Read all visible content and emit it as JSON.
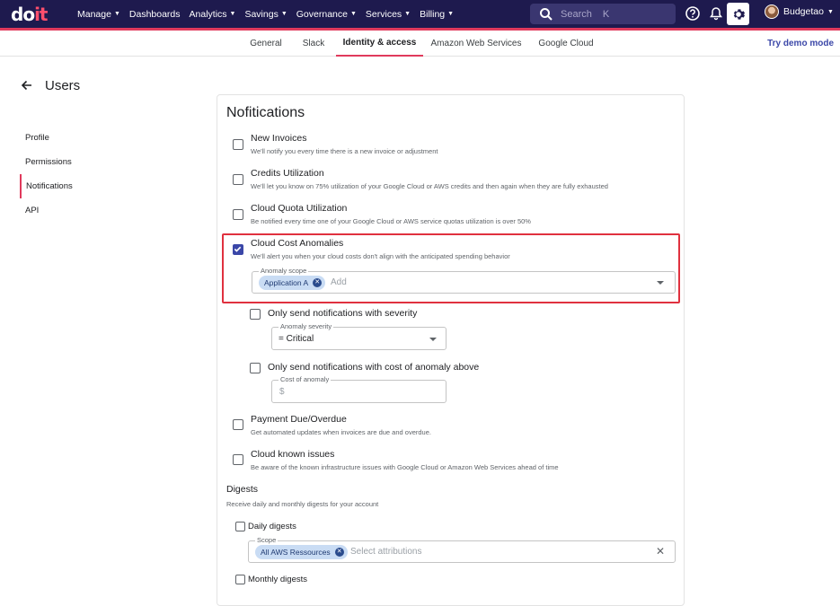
{
  "topbar": {
    "logo_main": "do",
    "logo_accent": "it",
    "nav": [
      {
        "label": "Manage",
        "has_menu": true
      },
      {
        "label": "Dashboards",
        "has_menu": false
      },
      {
        "label": "Analytics",
        "has_menu": true
      },
      {
        "label": "Savings",
        "has_menu": true
      },
      {
        "label": "Governance",
        "has_menu": true
      },
      {
        "label": "Services",
        "has_menu": true
      },
      {
        "label": "Billing",
        "has_menu": true
      }
    ],
    "search_placeholder": "Search",
    "search_shortcut": "K",
    "icons": [
      "help-icon",
      "bell-icon",
      "gear-icon"
    ],
    "user_name": "Budgetao"
  },
  "tabs": {
    "items": [
      "General",
      "Slack",
      "Identity & access",
      "Amazon Web Services",
      "Google Cloud"
    ],
    "active": "Identity & access",
    "demo_link": "Try demo mode"
  },
  "page": {
    "title": "Users",
    "sidebar": [
      "Profile",
      "Permissions",
      "Notifications",
      "API"
    ],
    "sidebar_active": "Notifications"
  },
  "notifications": {
    "title": "Nofitications",
    "options": [
      {
        "title": "New Invoices",
        "desc": "We'll notify you every time there is a new invoice or adjustment",
        "checked": false
      },
      {
        "title": "Credits Utilization",
        "desc": "We'll let you know on 75% utilization of your Google Cloud or AWS credits and then again when they are fully exhausted",
        "checked": false
      },
      {
        "title": "Cloud Quota Utilization",
        "desc": "Be notified every time one of your Google Cloud or AWS service quotas utilization is over 50%",
        "checked": false
      },
      {
        "title": "Cloud Cost Anomalies",
        "desc": "We'll alert you when your cloud costs don't align with the anticipated spending behavior",
        "checked": true
      },
      {
        "title": "Payment Due/Overdue",
        "desc": "Get automated updates when invoices are due and overdue.",
        "checked": false
      },
      {
        "title": "Cloud known issues",
        "desc": "Be aware of the known infrastructure issues with Google Cloud or Amazon Web Services ahead of time",
        "checked": false
      }
    ],
    "anomaly_scope": {
      "label": "Anomaly scope",
      "chips": [
        "Application A"
      ],
      "placeholder": "Add"
    },
    "severity_option": {
      "title": "Only send notifications with severity",
      "checked": false,
      "field_label": "Anomaly severity",
      "value": "= Critical"
    },
    "cost_option": {
      "title": "Only send notifications with cost of anomaly above",
      "checked": false,
      "field_label": "Cost of anomaly",
      "prefix": "$"
    }
  },
  "digests": {
    "title": "Digests",
    "desc": "Receive daily and monthly digests for your account",
    "daily": {
      "label": "Daily digests",
      "checked": false
    },
    "scope": {
      "label": "Scope",
      "chips": [
        "All AWS Ressources"
      ],
      "placeholder": "Select attributions"
    },
    "monthly": {
      "label": "Monthly digests",
      "checked": false
    }
  },
  "colors": {
    "topbar_bg": "#1e1a4e",
    "accent": "#e03a5c",
    "primary": "#3b47a8",
    "highlight_box": "#e0313f",
    "chip_bg": "#c9dcf4"
  }
}
